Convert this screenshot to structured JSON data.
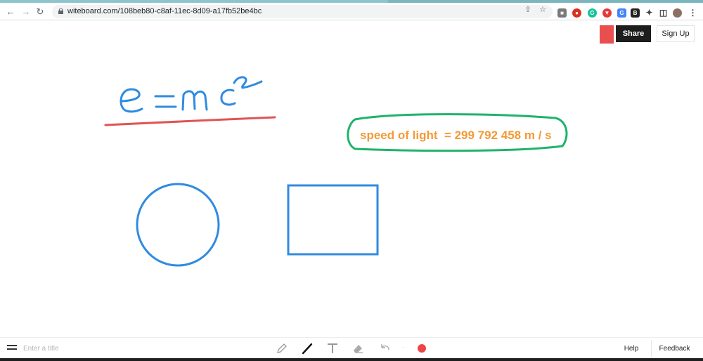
{
  "browser": {
    "url": "witeboard.com/108beb80-c8af-11ec-8d09-a17fb52be4bc"
  },
  "header": {
    "share_label": "Share",
    "signup_label": "Sign Up"
  },
  "board": {
    "equation_text": "e =mc²",
    "annotation_text": "speed of light  = 299 792 458 m / s",
    "colors": {
      "blue": "#2f8be0",
      "red_underline": "#e05454",
      "green_outline": "#1fb36b",
      "orange_text": "#f39a36"
    }
  },
  "toolbar": {
    "title_placeholder": "Enter a title",
    "tools": [
      "pencil-icon",
      "pen-icon",
      "text-icon",
      "eraser-icon",
      "undo-icon"
    ],
    "selected_color": "#ef4444",
    "help_label": "Help",
    "feedback_label": "Feedback"
  }
}
